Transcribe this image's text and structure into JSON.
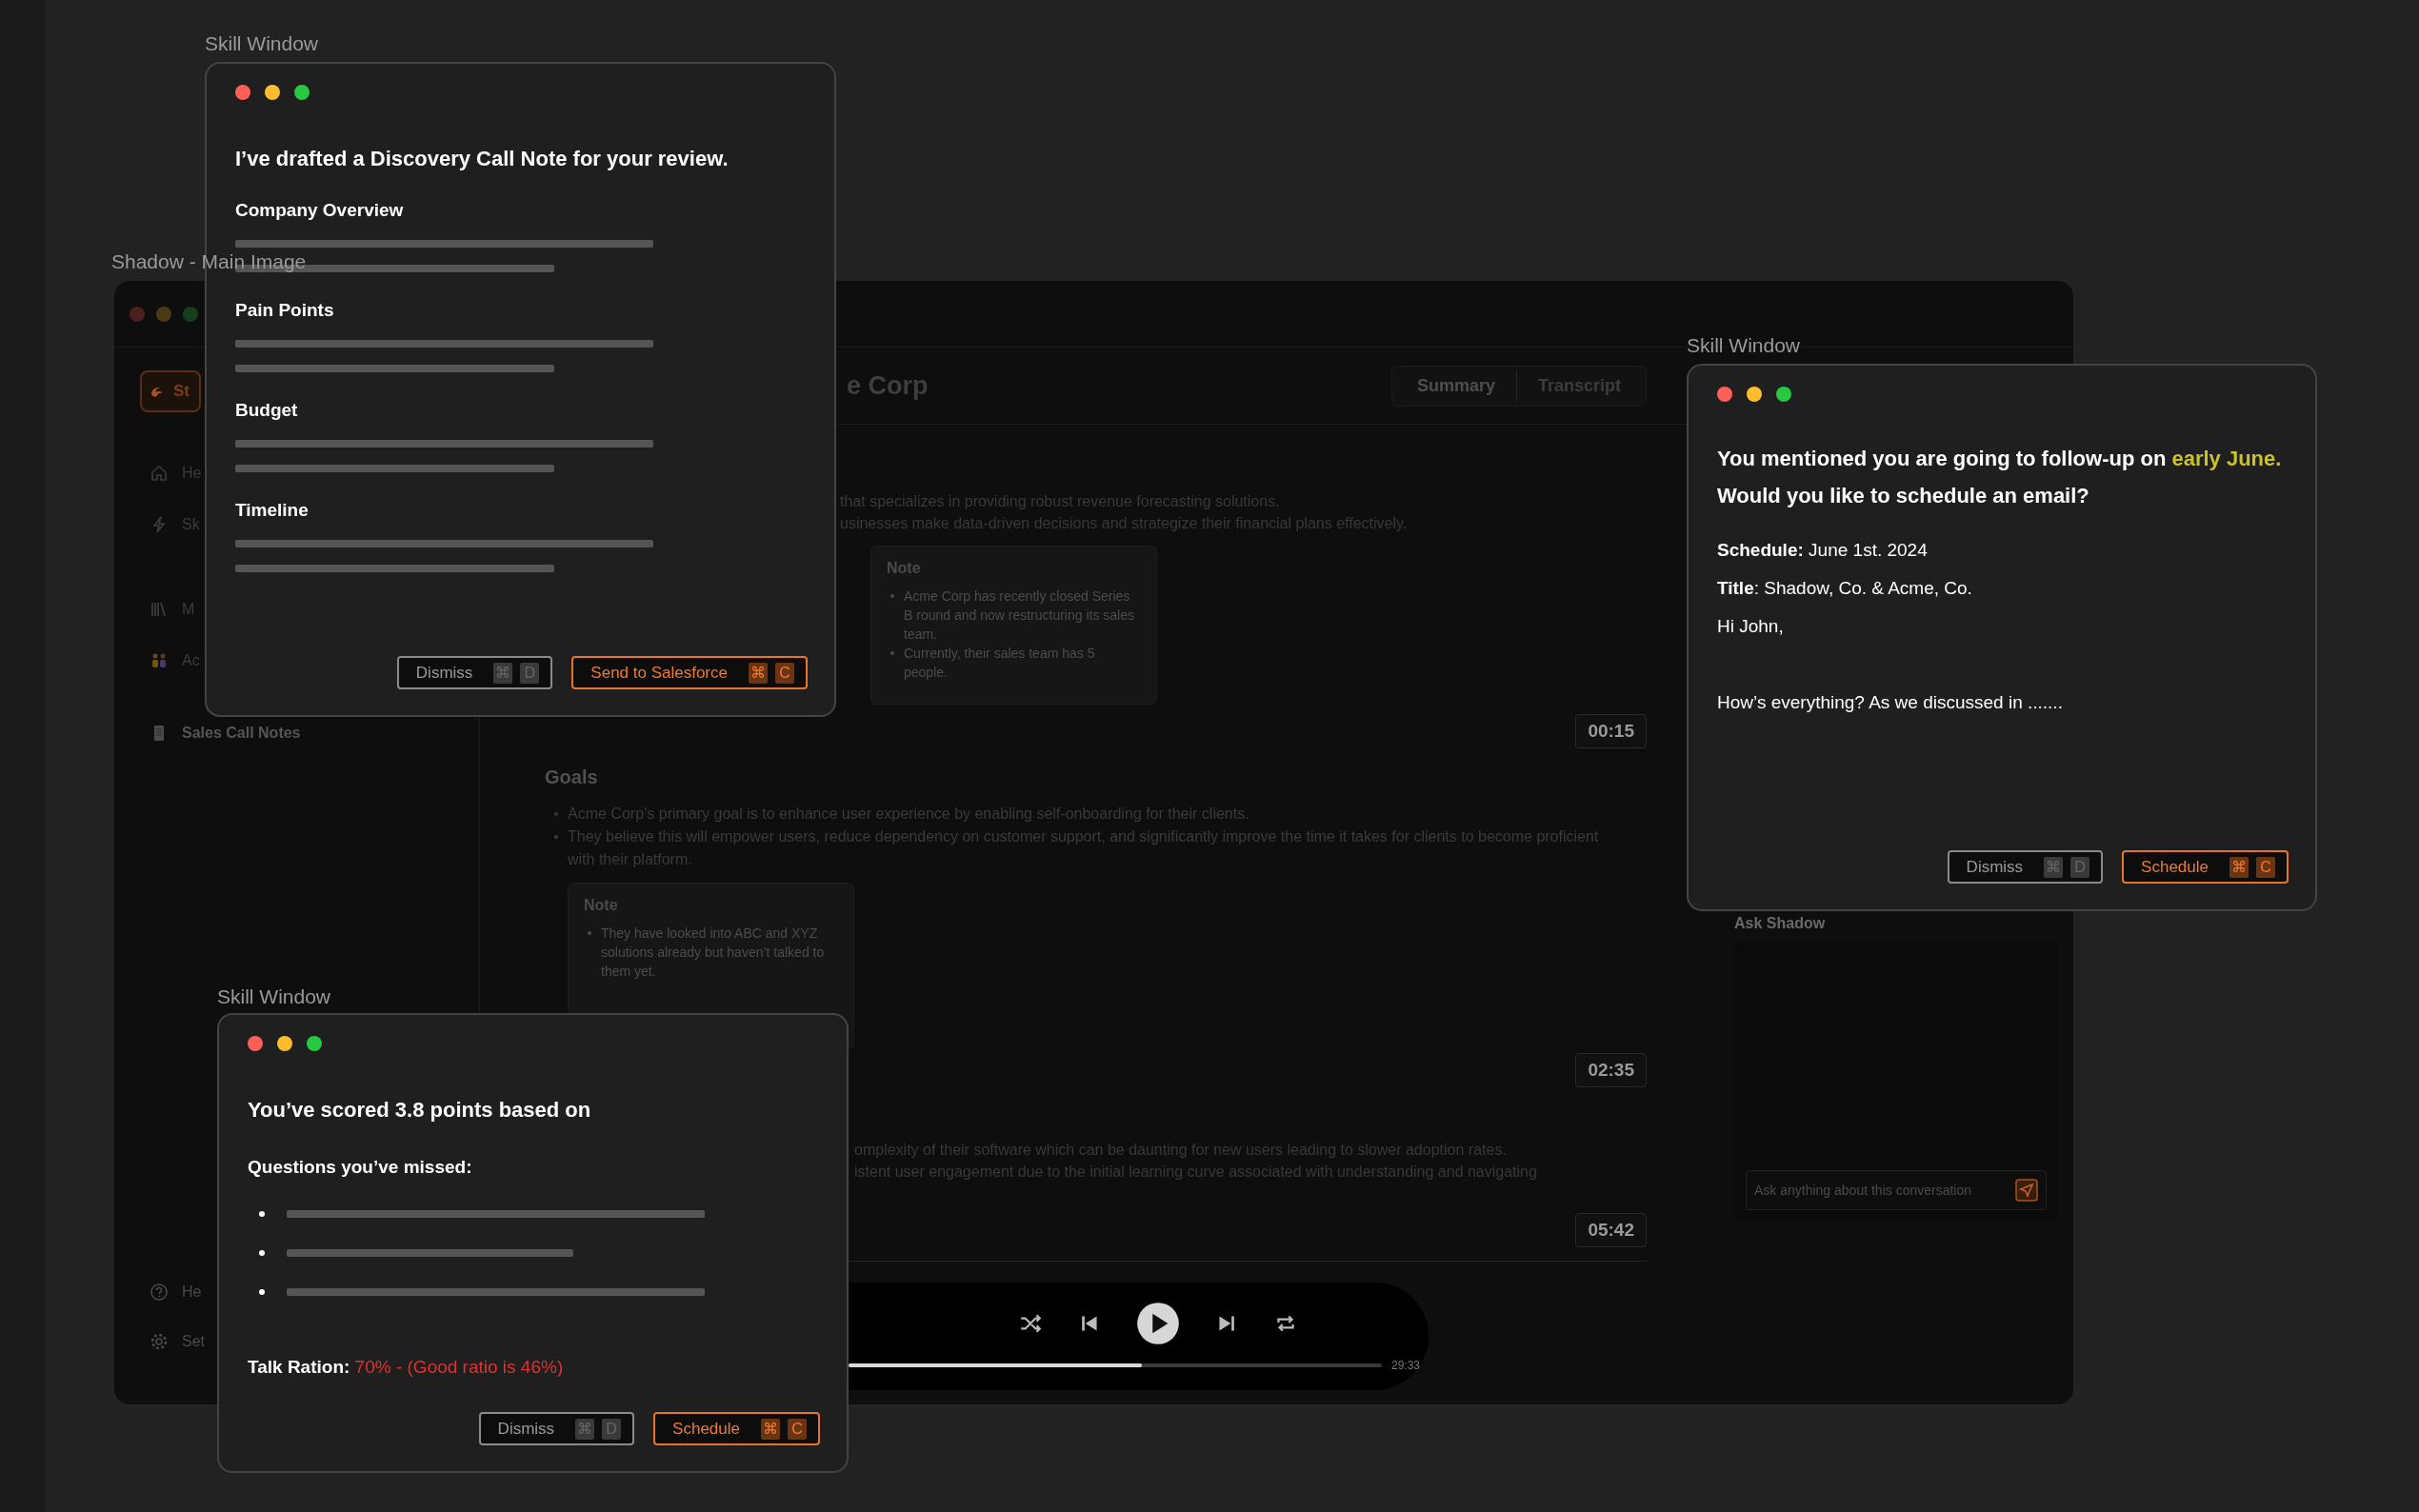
{
  "main_window": {
    "label": "Shadow - Main Image",
    "sidebar": {
      "primary_button": "St",
      "items": [
        {
          "label": "He",
          "selected": false
        },
        {
          "label": "Sk",
          "selected": false
        },
        {
          "label": "M",
          "selected": false
        },
        {
          "label": "Ac",
          "selected": false
        },
        {
          "label": "Sales Call Notes",
          "selected": true
        }
      ],
      "footer": [
        {
          "label": "He"
        },
        {
          "label": "Set"
        }
      ]
    },
    "header": {
      "title": "e Corp",
      "tabs": [
        {
          "label": "Summary",
          "selected": true
        },
        {
          "label": "Transcript",
          "selected": false
        }
      ]
    },
    "sections": [
      {
        "lines": [
          "that specializes in providing robust revenue forecasting solutions.",
          "usinesses make data-driven decisions and strategize their financial plans effectively."
        ],
        "note": {
          "title": "Note",
          "bullets": [
            "Acme Corp has recently closed Series B round and now restructuring its sales team.",
            "Currently, their sales team has 5 people."
          ]
        },
        "timestamp": "00:15"
      },
      {
        "title": "Goals",
        "bullets": [
          "Acme Corp’s primary goal is to enhance user experience by enabling self-onboarding for their clients.",
          "They believe this will empower users, reduce dependency on customer support, and significantly improve the time it takes for clients to become proficient with their platform."
        ],
        "note": {
          "title": "Note",
          "bullets": [
            "They have looked into ABC and XYZ solutions already but haven’t talked to them yet."
          ]
        },
        "timestamp": "02:35"
      },
      {
        "lines": [
          "omplexity of their software which can be daunting for new users leading to slower adoption rates.",
          "istent user engagement due to the initial learning curve associated with understanding and navigating"
        ],
        "timestamp": "05:42"
      }
    ],
    "player": {
      "level": 0.55,
      "time": "29:33"
    },
    "ask_panel": {
      "title": "Ask Shadow",
      "placeholder": "Ask anything about this conversation"
    }
  },
  "skill_windows": [
    {
      "kind": "draft",
      "label": "Skill Window",
      "heading": "I’ve drafted a Discovery Call Note for your review.",
      "sections": [
        "Company Overview",
        "Pain Points",
        "Budget",
        "Timeline"
      ],
      "buttons": [
        {
          "kind": "secondary",
          "label": "Dismiss",
          "keys": [
            "⌘",
            "D"
          ]
        },
        {
          "kind": "primary",
          "label": "Send to Salesforce",
          "keys": [
            "⌘",
            "C"
          ]
        }
      ]
    },
    {
      "kind": "email",
      "label": "Skill Window",
      "heading": [
        {
          "text": "You mentioned you are going to follow-up on ",
          "highlight": false
        },
        {
          "text": "early June.",
          "highlight": true
        },
        {
          "text": " Would you like to schedule an email?",
          "highlight": false
        }
      ],
      "fields": [
        "**Schedule:** June 1st. 2024",
        "**Title**: Shadow, Co. & Acme, Co."
      ],
      "body": [
        "Hi John,",
        "How’s everything? As we discussed in ......."
      ],
      "buttons": [
        {
          "kind": "secondary",
          "label": "Dismiss",
          "keys": [
            "⌘",
            "D"
          ]
        },
        {
          "kind": "primary",
          "label": "Schedule",
          "keys": [
            "⌘",
            "C"
          ]
        }
      ]
    },
    {
      "kind": "score",
      "label": "Skill Window",
      "heading": "You’ve scored 3.8 points based on",
      "subheading": "Questions you’ve missed:",
      "missed": [
        {
          "kind": "long"
        },
        {
          "kind": "short"
        },
        {
          "kind": "long"
        }
      ],
      "ratio": {
        "label": "Talk Ration:",
        "value": "70% - (Good ratio is 46%)"
      },
      "buttons": [
        {
          "kind": "secondary",
          "label": "Dismiss",
          "keys": [
            "⌘",
            "D"
          ]
        },
        {
          "kind": "primary",
          "label": "Schedule",
          "keys": [
            "⌘",
            "C"
          ]
        }
      ]
    }
  ]
}
